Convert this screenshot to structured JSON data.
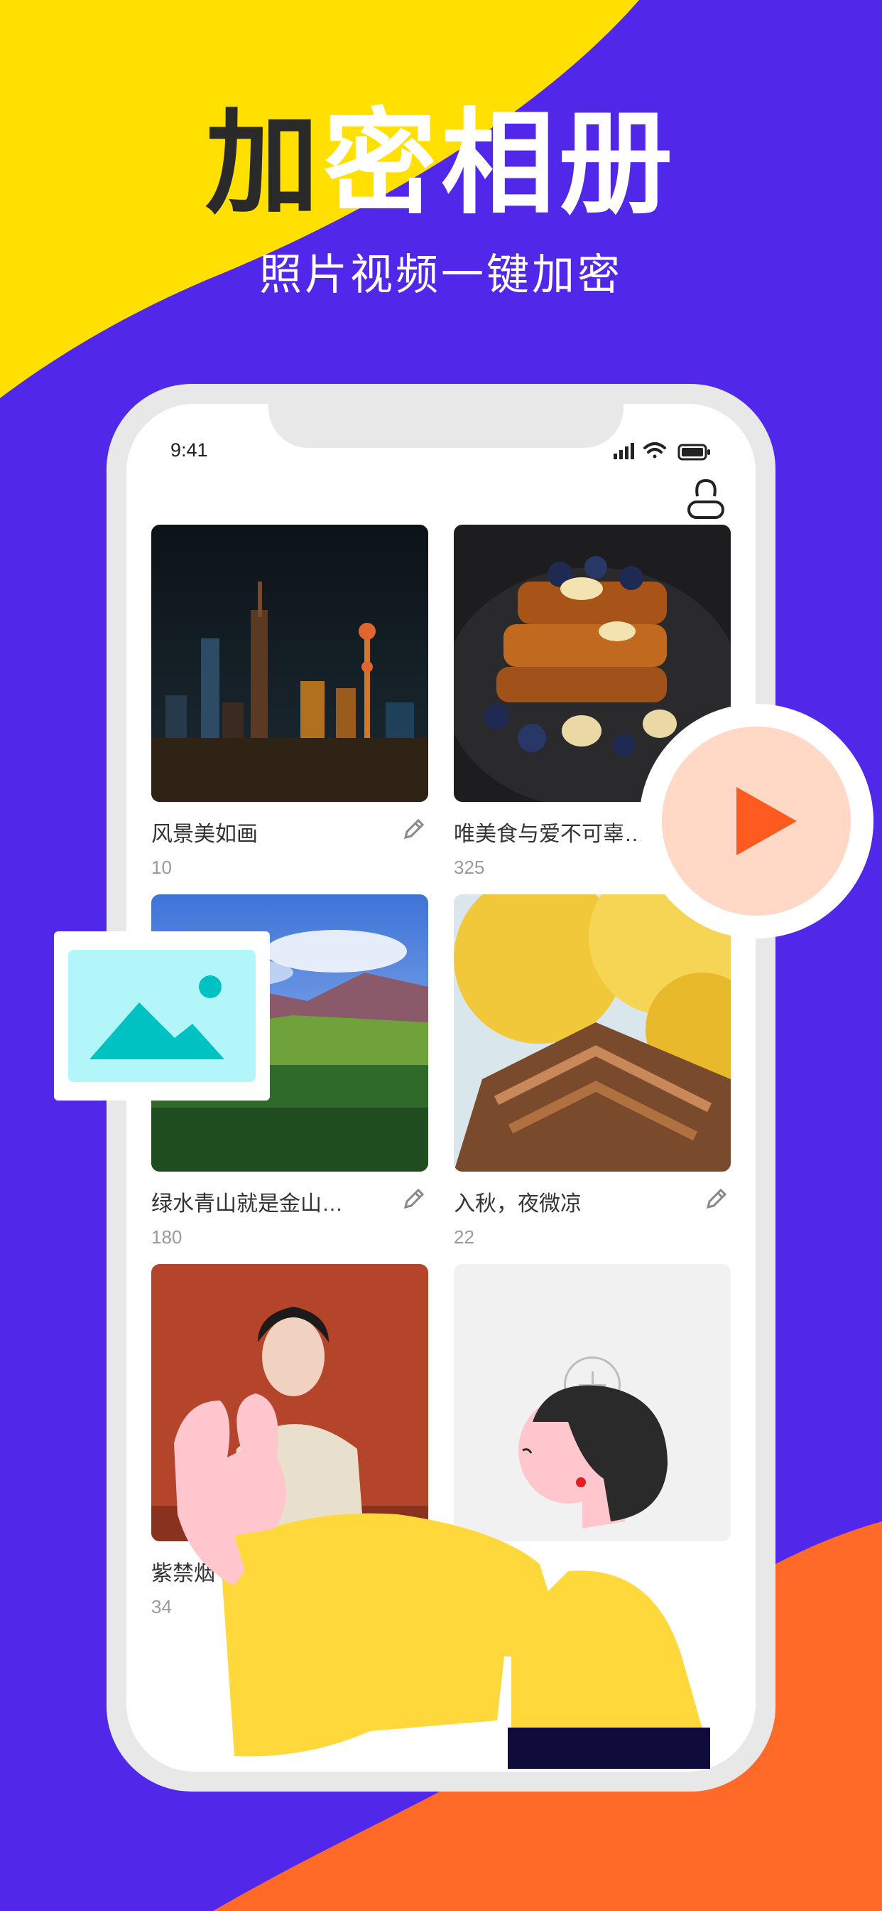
{
  "promo": {
    "title_part1": "加",
    "title_part2": "密相册",
    "subtitle": "照片视频一键加密"
  },
  "status_bar": {
    "time": "9:41"
  },
  "albums": [
    {
      "name": "风景美如画",
      "count": "10"
    },
    {
      "name": "唯美食与爱不可辜…",
      "count": "325"
    },
    {
      "name": "绿水青山就是金山…",
      "count": "180"
    },
    {
      "name": "入秋，夜微凉",
      "count": "22"
    },
    {
      "name": "紫禁烟",
      "count": "34"
    }
  ],
  "colors": {
    "purple_bg": "#5128e9",
    "yellow_bg": "#ffe000",
    "orange_bg": "#ff6a28",
    "play_accent": "#ff5a1f",
    "image_icon_teal": "#00c2c2"
  },
  "icons": [
    "signal-icon",
    "wifi-icon",
    "battery-icon",
    "profile-icon",
    "edit-icon",
    "add-album-icon",
    "play-icon",
    "image-icon"
  ]
}
